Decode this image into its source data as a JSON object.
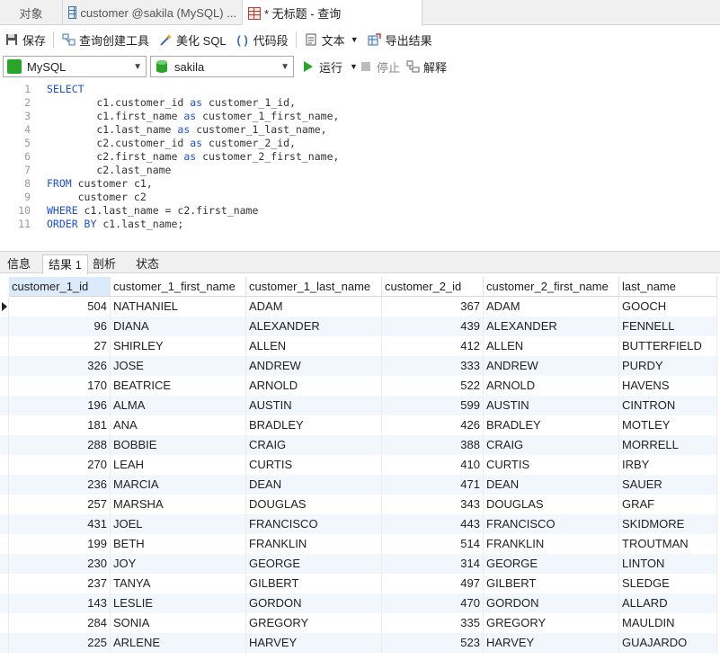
{
  "tabs": [
    {
      "label": "对象",
      "icon": "none"
    },
    {
      "label": "customer @sakila (MySQL) ...",
      "icon": "table-icon"
    },
    {
      "label": "* 无标题 - 查询",
      "icon": "query-icon"
    }
  ],
  "toolbar": {
    "save": "保存",
    "query_builder": "查询创建工具",
    "beautify": "美化 SQL",
    "snippet": "代码段",
    "text": "文本",
    "export": "导出结果"
  },
  "toolbar2": {
    "connection": "MySQL",
    "database": "sakila",
    "run": "运行",
    "stop": "停止",
    "explain": "解释"
  },
  "editor": {
    "lines": [
      {
        "n": "1",
        "parts": [
          {
            "t": "SELECT",
            "k": true
          }
        ]
      },
      {
        "n": "2",
        "parts": [
          {
            "t": "        c1.customer_id ",
            "k": false
          },
          {
            "t": "as",
            "k": true
          },
          {
            "t": " customer_1_id,",
            "k": false
          }
        ]
      },
      {
        "n": "3",
        "parts": [
          {
            "t": "        c1.first_name ",
            "k": false
          },
          {
            "t": "as",
            "k": true
          },
          {
            "t": " customer_1_first_name,",
            "k": false
          }
        ]
      },
      {
        "n": "4",
        "parts": [
          {
            "t": "        c1.last_name ",
            "k": false
          },
          {
            "t": "as",
            "k": true
          },
          {
            "t": " customer_1_last_name,",
            "k": false
          }
        ]
      },
      {
        "n": "5",
        "parts": [
          {
            "t": "        c2.customer_id ",
            "k": false
          },
          {
            "t": "as",
            "k": true
          },
          {
            "t": " customer_2_id,",
            "k": false
          }
        ]
      },
      {
        "n": "6",
        "parts": [
          {
            "t": "        c2.first_name ",
            "k": false
          },
          {
            "t": "as",
            "k": true
          },
          {
            "t": " customer_2_first_name,",
            "k": false
          }
        ]
      },
      {
        "n": "7",
        "parts": [
          {
            "t": "        c2.last_name",
            "k": false
          }
        ]
      },
      {
        "n": "8",
        "parts": [
          {
            "t": "FROM",
            "k": true
          },
          {
            "t": " customer c1,",
            "k": false
          }
        ]
      },
      {
        "n": "9",
        "parts": [
          {
            "t": "     customer c2",
            "k": false
          }
        ]
      },
      {
        "n": "10",
        "parts": [
          {
            "t": "WHERE",
            "k": true
          },
          {
            "t": " c1.last_name = c2.first_name",
            "k": false
          }
        ]
      },
      {
        "n": "11",
        "parts": [
          {
            "t": "ORDER BY",
            "k": true
          },
          {
            "t": " c1.last_name;",
            "k": false
          }
        ]
      }
    ]
  },
  "result_tabs": [
    "信息",
    "结果 1",
    "剖析",
    "状态"
  ],
  "result": {
    "columns": [
      "customer_1_id",
      "customer_1_first_name",
      "customer_1_last_name",
      "customer_2_id",
      "customer_2_first_name",
      "last_name"
    ],
    "rows": [
      [
        "504",
        "NATHANIEL",
        "ADAM",
        "367",
        "ADAM",
        "GOOCH"
      ],
      [
        "96",
        "DIANA",
        "ALEXANDER",
        "439",
        "ALEXANDER",
        "FENNELL"
      ],
      [
        "27",
        "SHIRLEY",
        "ALLEN",
        "412",
        "ALLEN",
        "BUTTERFIELD"
      ],
      [
        "326",
        "JOSE",
        "ANDREW",
        "333",
        "ANDREW",
        "PURDY"
      ],
      [
        "170",
        "BEATRICE",
        "ARNOLD",
        "522",
        "ARNOLD",
        "HAVENS"
      ],
      [
        "196",
        "ALMA",
        "AUSTIN",
        "599",
        "AUSTIN",
        "CINTRON"
      ],
      [
        "181",
        "ANA",
        "BRADLEY",
        "426",
        "BRADLEY",
        "MOTLEY"
      ],
      [
        "288",
        "BOBBIE",
        "CRAIG",
        "388",
        "CRAIG",
        "MORRELL"
      ],
      [
        "270",
        "LEAH",
        "CURTIS",
        "410",
        "CURTIS",
        "IRBY"
      ],
      [
        "236",
        "MARCIA",
        "DEAN",
        "471",
        "DEAN",
        "SAUER"
      ],
      [
        "257",
        "MARSHA",
        "DOUGLAS",
        "343",
        "DOUGLAS",
        "GRAF"
      ],
      [
        "431",
        "JOEL",
        "FRANCISCO",
        "443",
        "FRANCISCO",
        "SKIDMORE"
      ],
      [
        "199",
        "BETH",
        "FRANKLIN",
        "514",
        "FRANKLIN",
        "TROUTMAN"
      ],
      [
        "230",
        "JOY",
        "GEORGE",
        "314",
        "GEORGE",
        "LINTON"
      ],
      [
        "237",
        "TANYA",
        "GILBERT",
        "497",
        "GILBERT",
        "SLEDGE"
      ],
      [
        "143",
        "LESLIE",
        "GORDON",
        "470",
        "GORDON",
        "ALLARD"
      ],
      [
        "284",
        "SONIA",
        "GREGORY",
        "335",
        "GREGORY",
        "MAULDIN"
      ],
      [
        "225",
        "ARLENE",
        "HARVEY",
        "523",
        "HARVEY",
        "GUAJARDO"
      ]
    ]
  },
  "colors": {
    "keyword": "#1d4fd8",
    "accent": "#dcebfb",
    "run": "#2aa52a"
  }
}
